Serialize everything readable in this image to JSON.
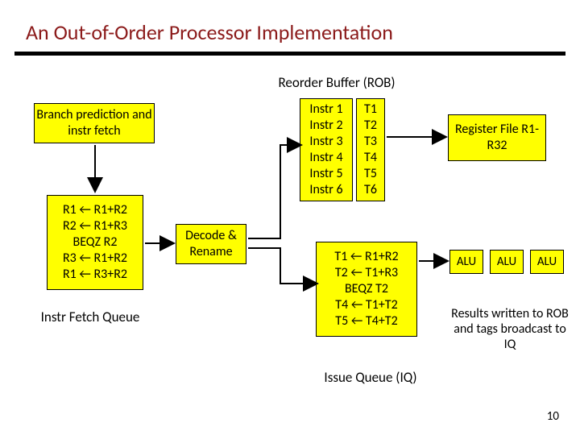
{
  "title": "An Out-of-Order Processor Implementation",
  "labels": {
    "rob": "Reorder Buffer (ROB)",
    "iq": "Issue Queue (IQ)",
    "fetchq": "Instr Fetch Queue",
    "results": "Results written to ROB and tags broadcast to IQ"
  },
  "boxes": {
    "branch_predict": "Branch prediction and instr fetch",
    "decode": "Decode & Rename",
    "regfile": "Register File R1-R32",
    "alu": "ALU"
  },
  "fetch_code": [
    "R1 ← R1+R2",
    "R2 ← R1+R3",
    "BEQZ R2",
    "R3 ← R1+R2",
    "R1 ← R3+R2"
  ],
  "rob_instr": [
    "Instr 1",
    "Instr 2",
    "Instr 3",
    "Instr 4",
    "Instr 5",
    "Instr 6"
  ],
  "rob_tag": [
    "T1",
    "T2",
    "T3",
    "T4",
    "T5",
    "T6"
  ],
  "iq_code": [
    "T1 ← R1+R2",
    "T2 ← T1+R3",
    "BEQZ T2",
    "T4 ← T1+T2",
    "T5 ← T4+T2"
  ],
  "page": "10"
}
